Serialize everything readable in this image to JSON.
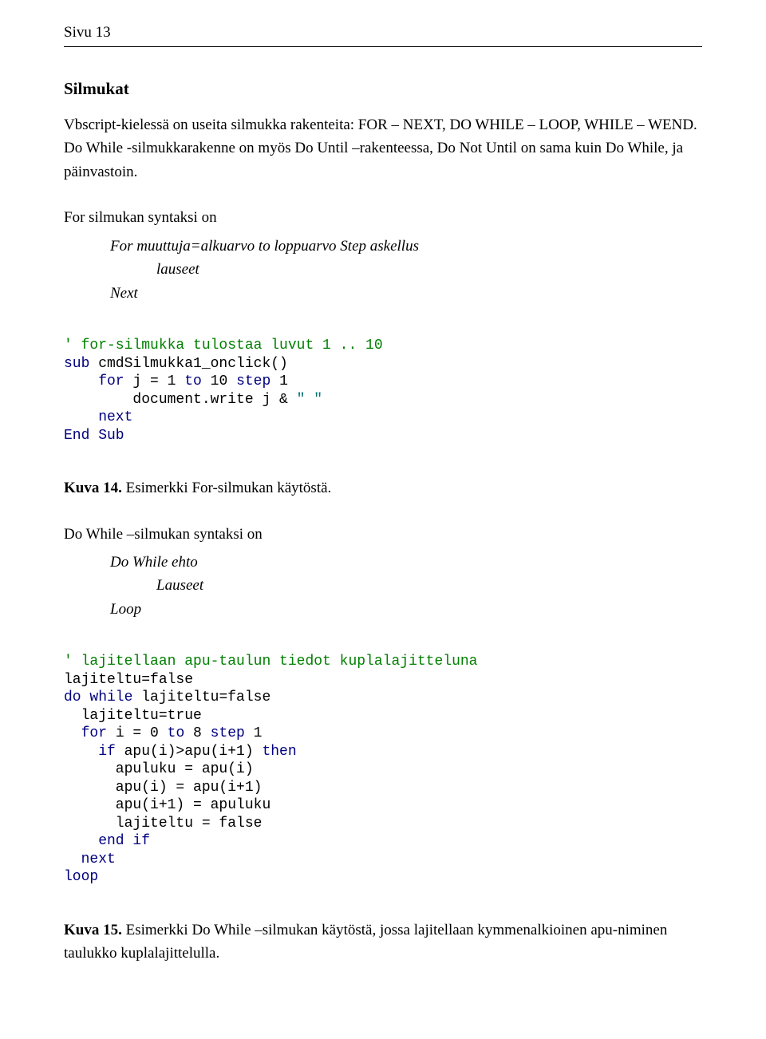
{
  "header": "Sivu 13",
  "title": "Silmukat",
  "intro": "Vbscript-kielessä on useita silmukka rakenteita: FOR – NEXT, DO WHILE – LOOP, WHILE – WEND. Do While -silmukkarakenne on myös Do Until –rakenteessa, Do Not Until on sama kuin Do While, ja päinvastoin.",
  "forTitle": "For silmukan syntaksi on",
  "forSyntax": {
    "l1": "For muuttuja=alkuarvo to loppuarvo Step askellus",
    "l2": "lauseet",
    "l3": "Next"
  },
  "code1": {
    "c1": "' for-silmukka tulostaa luvut 1 .. 10",
    "c2a": "sub",
    "c2b": " cmdSilmukka1_onclick()",
    "c3a": "    for",
    "c3b": " j = 1 ",
    "c3c": "to",
    "c3d": " 10 ",
    "c3e": "step",
    "c3f": " 1",
    "c4": "        document.write j & ",
    "c4q": "\" \"",
    "c5": "    next",
    "c6": "End Sub"
  },
  "caption1b": "Kuva 14.",
  "caption1t": " Esimerkki For-silmukan käytöstä.",
  "doTitle": "Do While –silmukan syntaksi on",
  "doSyntax": {
    "l1": "Do While ehto",
    "l2": "Lauseet",
    "l3": "Loop"
  },
  "code2": {
    "c1": "' lajitellaan apu-taulun tiedot kuplalajitteluna",
    "c2": "lajiteltu=false",
    "c3a": "do while",
    "c3b": " lajiteltu=false",
    "c4": "  lajiteltu=true",
    "c5a": "  for",
    "c5b": " i = 0 ",
    "c5c": "to",
    "c5d": " 8 ",
    "c5e": "step",
    "c5f": " 1",
    "c6a": "    if",
    "c6b": " apu(i)>apu(i+1) ",
    "c6c": "then",
    "c7": "      apuluku = apu(i)",
    "c8": "      apu(i) = apu(i+1)",
    "c9": "      apu(i+1) = apuluku",
    "c10": "      lajiteltu = false",
    "c11": "    end if",
    "c12": "  next",
    "c13": "loop"
  },
  "caption2b": "Kuva 15.",
  "caption2t": " Esimerkki Do While –silmukan käytöstä, jossa lajitellaan kymmenalkioinen apu-niminen taulukko kuplalajittelulla."
}
